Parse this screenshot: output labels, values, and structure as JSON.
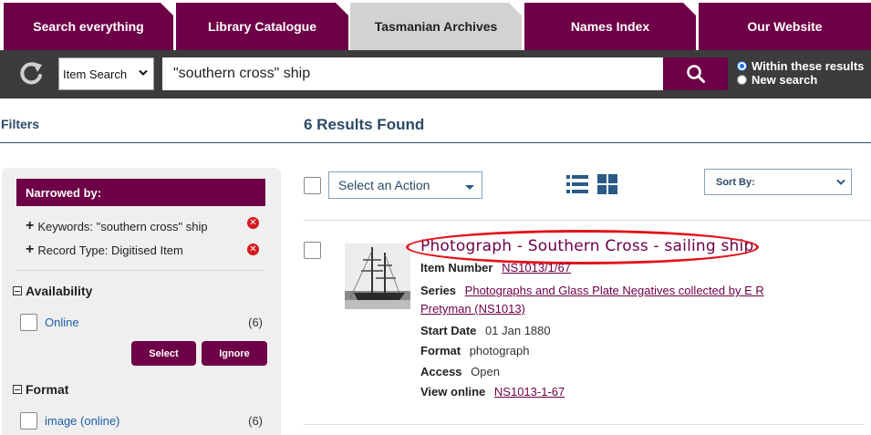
{
  "tabs": [
    {
      "label": "Search everything",
      "active": false
    },
    {
      "label": "Library Catalogue",
      "active": false
    },
    {
      "label": "Tasmanian Archives",
      "active": true
    },
    {
      "label": "Names Index",
      "active": false
    },
    {
      "label": "Our Website",
      "active": false
    }
  ],
  "search": {
    "type_value": "Item Search",
    "query": "\"southern cross\" ship",
    "radio_within": "Within these results",
    "radio_new": "New search"
  },
  "filters": {
    "title": "Filters",
    "narrowed_by": "Narrowed by:",
    "active_filters": [
      "Keywords: \"southern cross\" ship",
      "Record Type: Digitised Item"
    ],
    "facets": [
      {
        "name": "Availability",
        "options": [
          {
            "label": "Online",
            "count": "(6)"
          }
        ]
      },
      {
        "name": "Format",
        "options": [
          {
            "label": "image (online)",
            "count": "(6)"
          }
        ]
      }
    ],
    "select_label": "Select",
    "ignore_label": "Ignore"
  },
  "results": {
    "heading": "6 Results Found",
    "action_placeholder": "Select an Action",
    "sort_label": "Sort By:",
    "items": [
      {
        "title": "Photograph - Southern Cross - sailing ship",
        "item_number_label": "Item Number",
        "item_number": "NS1013/1/67",
        "series_label": "Series",
        "series_line1": "Photographs and Glass Plate Negatives collected by E R",
        "series_line2": "Pretyman (NS1013)",
        "start_date_label": "Start Date",
        "start_date": "01 Jan 1880",
        "format_label": "Format",
        "format": "photograph",
        "access_label": "Access",
        "access": "Open",
        "view_online_label": "View online",
        "view_online": "NS1013-1-67"
      }
    ]
  },
  "colors": {
    "brand": "#6d0046",
    "active_tab": "#d2d2d2",
    "search_bar": "#3c3c3c",
    "heading": "#2b4a66",
    "highlight": "#e2141b",
    "link": "#1f5fa6"
  },
  "icons": [
    "refresh-icon",
    "chevron-down-icon",
    "search-icon",
    "remove-icon",
    "list-view-icon",
    "grid-view-icon",
    "caret-down-icon"
  ]
}
